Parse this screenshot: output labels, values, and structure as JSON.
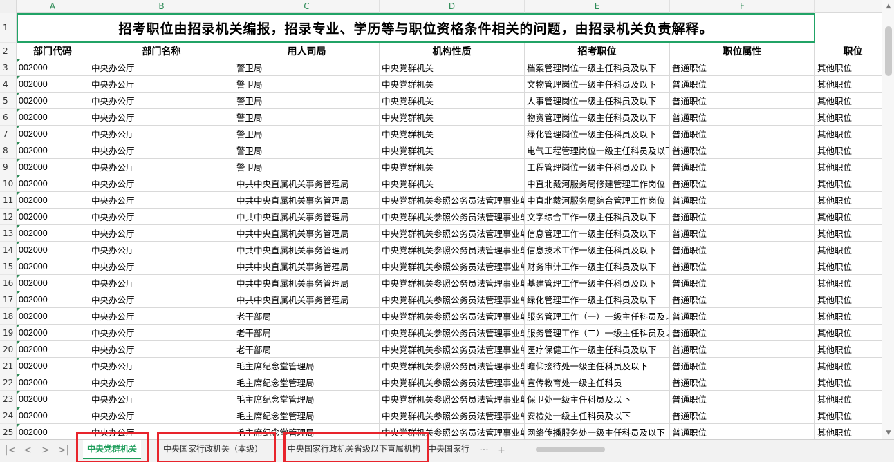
{
  "columns": [
    "A",
    "B",
    "C",
    "D",
    "E",
    "F"
  ],
  "title": "招考职位由招录机关编报，招录专业、学历等与职位资格条件相关的问题，由招录机关负责解释。",
  "headers": [
    "部门代码",
    "部门名称",
    "用人司局",
    "机构性质",
    "招考职位",
    "职位属性",
    "职位"
  ],
  "rows": [
    {
      "n": "3",
      "c": [
        "002000",
        "中央办公厅",
        "警卫局",
        "中央党群机关",
        "档案管理岗位一级主任科员及以下",
        "普通职位",
        "其他职位"
      ]
    },
    {
      "n": "4",
      "c": [
        "002000",
        "中央办公厅",
        "警卫局",
        "中央党群机关",
        "文物管理岗位一级主任科员及以下",
        "普通职位",
        "其他职位"
      ]
    },
    {
      "n": "5",
      "c": [
        "002000",
        "中央办公厅",
        "警卫局",
        "中央党群机关",
        "人事管理岗位一级主任科员及以下",
        "普通职位",
        "其他职位"
      ]
    },
    {
      "n": "6",
      "c": [
        "002000",
        "中央办公厅",
        "警卫局",
        "中央党群机关",
        "物资管理岗位一级主任科员及以下",
        "普通职位",
        "其他职位"
      ]
    },
    {
      "n": "7",
      "c": [
        "002000",
        "中央办公厅",
        "警卫局",
        "中央党群机关",
        "绿化管理岗位一级主任科员及以下",
        "普通职位",
        "其他职位"
      ]
    },
    {
      "n": "8",
      "c": [
        "002000",
        "中央办公厅",
        "警卫局",
        "中央党群机关",
        "电气工程管理岗位一级主任科员及以下",
        "普通职位",
        "其他职位"
      ]
    },
    {
      "n": "9",
      "c": [
        "002000",
        "中央办公厅",
        "警卫局",
        "中央党群机关",
        "工程管理岗位一级主任科员及以下",
        "普通职位",
        "其他职位"
      ]
    },
    {
      "n": "10",
      "c": [
        "002000",
        "中央办公厅",
        "中共中央直属机关事务管理局",
        "中央党群机关",
        "中直北戴河服务局修建管理工作岗位",
        "普通职位",
        "其他职位"
      ]
    },
    {
      "n": "11",
      "c": [
        "002000",
        "中央办公厅",
        "中共中央直属机关事务管理局",
        "中央党群机关参照公务员法管理事业单位",
        "中直北戴河服务局综合管理工作岗位",
        "普通职位",
        "其他职位"
      ]
    },
    {
      "n": "12",
      "c": [
        "002000",
        "中央办公厅",
        "中共中央直属机关事务管理局",
        "中央党群机关参照公务员法管理事业单位",
        "文字综合工作一级主任科员及以下",
        "普通职位",
        "其他职位"
      ]
    },
    {
      "n": "13",
      "c": [
        "002000",
        "中央办公厅",
        "中共中央直属机关事务管理局",
        "中央党群机关参照公务员法管理事业单位",
        "信息管理工作一级主任科员及以下",
        "普通职位",
        "其他职位"
      ]
    },
    {
      "n": "14",
      "c": [
        "002000",
        "中央办公厅",
        "中共中央直属机关事务管理局",
        "中央党群机关参照公务员法管理事业单位",
        "信息技术工作一级主任科员及以下",
        "普通职位",
        "其他职位"
      ]
    },
    {
      "n": "15",
      "c": [
        "002000",
        "中央办公厅",
        "中共中央直属机关事务管理局",
        "中央党群机关参照公务员法管理事业单位",
        "财务审计工作一级主任科员及以下",
        "普通职位",
        "其他职位"
      ]
    },
    {
      "n": "16",
      "c": [
        "002000",
        "中央办公厅",
        "中共中央直属机关事务管理局",
        "中央党群机关参照公务员法管理事业单位",
        "基建管理工作一级主任科员及以下",
        "普通职位",
        "其他职位"
      ]
    },
    {
      "n": "17",
      "c": [
        "002000",
        "中央办公厅",
        "中共中央直属机关事务管理局",
        "中央党群机关参照公务员法管理事业单位",
        "绿化管理工作一级主任科员及以下",
        "普通职位",
        "其他职位"
      ]
    },
    {
      "n": "18",
      "c": [
        "002000",
        "中央办公厅",
        "老干部局",
        "中央党群机关参照公务员法管理事业单位",
        "服务管理工作（一）一级主任科员及以下",
        "普通职位",
        "其他职位"
      ]
    },
    {
      "n": "19",
      "c": [
        "002000",
        "中央办公厅",
        "老干部局",
        "中央党群机关参照公务员法管理事业单位",
        "服务管理工作（二）一级主任科员及以下",
        "普通职位",
        "其他职位"
      ]
    },
    {
      "n": "20",
      "c": [
        "002000",
        "中央办公厅",
        "老干部局",
        "中央党群机关参照公务员法管理事业单位",
        "医疗保健工作一级主任科员及以下",
        "普通职位",
        "其他职位"
      ]
    },
    {
      "n": "21",
      "c": [
        "002000",
        "中央办公厅",
        "毛主席纪念堂管理局",
        "中央党群机关参照公务员法管理事业单位",
        "瞻仰接待处一级主任科员及以下",
        "普通职位",
        "其他职位"
      ]
    },
    {
      "n": "22",
      "c": [
        "002000",
        "中央办公厅",
        "毛主席纪念堂管理局",
        "中央党群机关参照公务员法管理事业单位",
        "宣传教育处一级主任科员",
        "普通职位",
        "其他职位"
      ]
    },
    {
      "n": "23",
      "c": [
        "002000",
        "中央办公厅",
        "毛主席纪念堂管理局",
        "中央党群机关参照公务员法管理事业单位",
        "保卫处一级主任科员及以下",
        "普通职位",
        "其他职位"
      ]
    },
    {
      "n": "24",
      "c": [
        "002000",
        "中央办公厅",
        "毛主席纪念堂管理局",
        "中央党群机关参照公务员法管理事业单位",
        "安检处一级主任科员及以下",
        "普通职位",
        "其他职位"
      ]
    },
    {
      "n": "25",
      "c": [
        "002000",
        "中央办公厅",
        "毛主席纪念堂管理局",
        "中央党群机关参照公务员法管理事业单位",
        "网络传播服务处一级主任科员及以下",
        "普通职位",
        "其他职位"
      ]
    }
  ],
  "tabs": [
    "中央党群机关",
    "中央国家行政机关（本级）",
    "中央国家行政机关省级以下直属机构",
    "中央国家行"
  ],
  "nav": {
    "first": "|<",
    "prev": "<",
    "next": ">",
    "last": ">|",
    "more": "···",
    "add": "+"
  },
  "colors": {
    "accent": "#1e9d5a",
    "highlight": "#e8242c"
  }
}
